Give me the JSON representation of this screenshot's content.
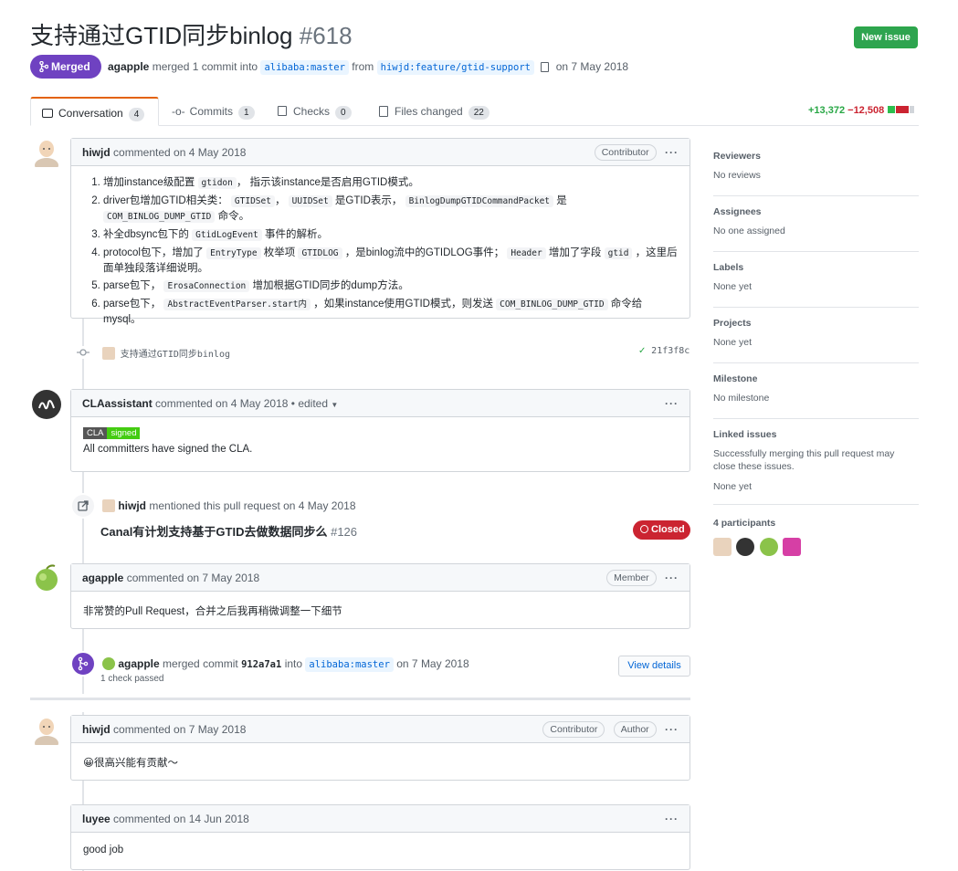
{
  "header": {
    "title": "支持通过GTID同步binlog",
    "number": "#618",
    "new_issue": "New issue",
    "state": "Merged",
    "author": "agapple",
    "action": "merged 1 commit into",
    "base_branch": "alibaba:master",
    "from_word": "from",
    "head_branch": "hiwjd:feature/gtid-support",
    "date": "on 7 May 2018"
  },
  "tabs": [
    {
      "label": "Conversation",
      "count": "4"
    },
    {
      "label": "Commits",
      "count": "1"
    },
    {
      "label": "Checks",
      "count": "0"
    },
    {
      "label": "Files changed",
      "count": "22"
    }
  ],
  "diffstat": {
    "additions": "+13,372",
    "deletions": "−12,508"
  },
  "comment1": {
    "author": "hiwjd",
    "meta": "commented on 4 May 2018",
    "badge": "Contributor",
    "items": [
      [
        "增加instance级配置 ",
        "gtidon",
        "， 指示该instance是否启用GTID模式。"
      ],
      [
        "driver包增加GTID相关类： ",
        "GTIDSet",
        "， ",
        "UUIDSet",
        " 是GTID表示， ",
        "BinlogDumpGTIDCommandPacket",
        " 是 ",
        "COM_BINLOG_DUMP_GTID",
        " 命令。"
      ],
      [
        "补全dbsync包下的 ",
        "GtidLogEvent",
        " 事件的解析。"
      ],
      [
        "protocol包下，增加了 ",
        "EntryType",
        " 枚举项 ",
        "GTIDLOG",
        " ，是binlog流中的GTIDLOG事件； ",
        "Header",
        " 增加了字段 ",
        "gtid",
        " ，这里后面单独段落详细说明。"
      ],
      [
        "parse包下， ",
        "ErosaConnection",
        " 增加根据GTID同步的dump方法。"
      ],
      [
        "parse包下， ",
        "AbstractEventParser.start内",
        " ，如果instance使用GTID模式，则发送 ",
        "COM_BINLOG_DUMP_GTID",
        " 命令给mysql。"
      ]
    ]
  },
  "commit_event": {
    "message": "支持通过GTID同步binlog",
    "sha": "21f3f8c"
  },
  "comment2": {
    "author": "CLAassistant",
    "meta": "commented on 4 May 2018 • edited",
    "cla_left": "CLA",
    "cla_right": "signed",
    "body": "All committers have signed the CLA."
  },
  "mention_event": {
    "author": "hiwjd",
    "text": "mentioned this pull request on 4 May 2018",
    "issue_title": "Canal有计划支持基于GTID去做数据同步么",
    "issue_number": "#126",
    "state": "Closed"
  },
  "comment3": {
    "author": "agapple",
    "meta": "commented on 7 May 2018",
    "badge": "Member",
    "body": "非常赞的Pull Request，合并之后我再稍微调整一下细节"
  },
  "merge_event": {
    "author": "agapple",
    "text1": "merged commit",
    "sha": "912a7a1",
    "text2": "into",
    "branch": "alibaba:master",
    "date": "on 7 May 2018",
    "checks": "1 check passed",
    "button": "View details"
  },
  "comment4": {
    "author": "hiwjd",
    "meta": "commented on 7 May 2018",
    "badge1": "Contributor",
    "badge2": "Author",
    "body": "😀很高兴能有贡献～"
  },
  "comment5": {
    "author": "luyee",
    "meta": "commented on 14 Jun 2018",
    "body": "good job"
  },
  "sidebar": {
    "reviewers": {
      "title": "Reviewers",
      "value": "No reviews"
    },
    "assignees": {
      "title": "Assignees",
      "value": "No one assigned"
    },
    "labels": {
      "title": "Labels",
      "value": "None yet"
    },
    "projects": {
      "title": "Projects",
      "value": "None yet"
    },
    "milestone": {
      "title": "Milestone",
      "value": "No milestone"
    },
    "linked": {
      "title": "Linked issues",
      "desc": "Successfully merging this pull request may close these issues.",
      "value": "None yet"
    },
    "participants": {
      "title": "4 participants"
    }
  },
  "colors": {
    "merged": "#6f42c1",
    "green": "#2ea44f",
    "closed": "#cb2431",
    "link": "#0366d6"
  }
}
